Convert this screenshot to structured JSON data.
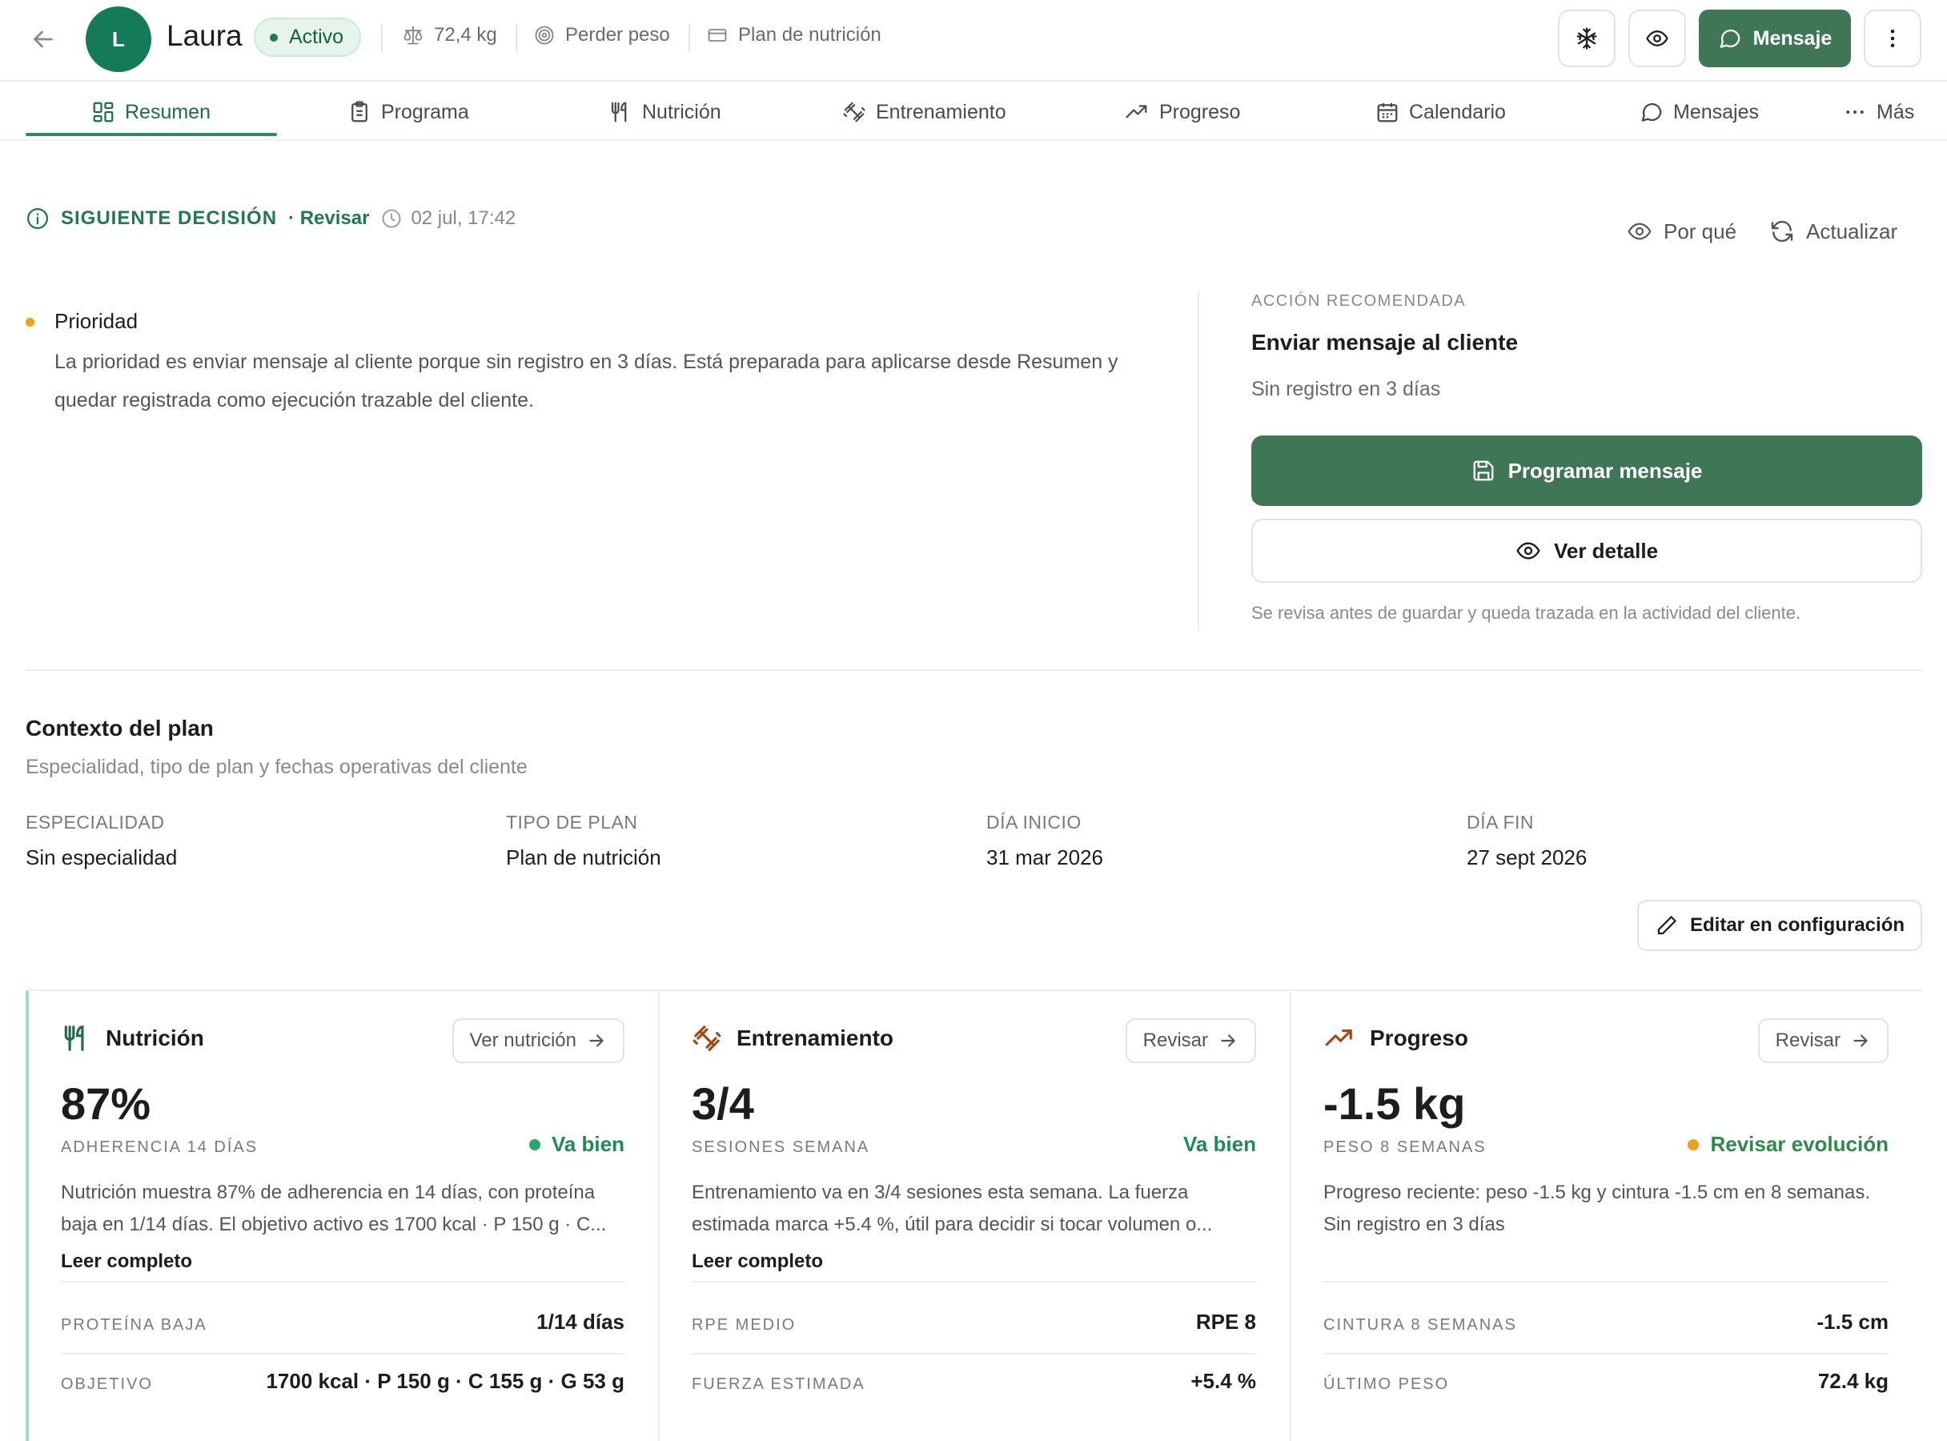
{
  "header": {
    "avatar_initial": "L",
    "client_name": "Laura",
    "status": "Activo",
    "weight": "72,4 kg",
    "goal": "Perder peso",
    "plan": "Plan de nutrición",
    "message_button": "Mensaje"
  },
  "tabs": [
    {
      "label": "Resumen",
      "icon": "dashboard-icon",
      "active": true
    },
    {
      "label": "Programa",
      "icon": "clipboard-icon"
    },
    {
      "label": "Nutrición",
      "icon": "utensils-icon"
    },
    {
      "label": "Entrenamiento",
      "icon": "dumbbell-icon"
    },
    {
      "label": "Progreso",
      "icon": "trend-up-icon"
    },
    {
      "label": "Calendario",
      "icon": "calendar-icon"
    },
    {
      "label": "Mensajes",
      "icon": "chat-icon"
    },
    {
      "label": "Más",
      "icon": "more-horizontal-icon"
    }
  ],
  "decision": {
    "title": "SIGUIENTE DECISIÓN",
    "link": "· Revisar",
    "time": "02 jul, 17:42",
    "why": "Por qué",
    "refresh": "Actualizar",
    "priority_title": "Prioridad",
    "priority_text": "La prioridad es enviar mensaje al cliente porque sin registro en 3 días. Está preparada para aplicarse desde Resumen y quedar registrada como ejecución trazable del cliente."
  },
  "recommended": {
    "label": "ACCIÓN RECOMENDADA",
    "title": "Enviar mensaje al cliente",
    "subtitle": "Sin registro en 3 días",
    "primary_button": "Programar mensaje",
    "secondary_button": "Ver detalle",
    "note": "Se revisa antes de guardar y queda trazada en la actividad del cliente."
  },
  "context": {
    "title": "Contexto del plan",
    "subtitle": "Especialidad, tipo de plan y fechas operativas del cliente",
    "fields": [
      {
        "label": "ESPECIALIDAD",
        "value": "Sin especialidad"
      },
      {
        "label": "TIPO DE PLAN",
        "value": "Plan de nutrición"
      },
      {
        "label": "DÍA INICIO",
        "value": "31 mar 2026"
      },
      {
        "label": "DÍA FIN",
        "value": "27 sept 2026"
      }
    ],
    "edit_button": "Editar en configuración"
  },
  "cards": [
    {
      "title": "Nutrición",
      "icon": "utensils-icon",
      "button": "Ver nutrición",
      "value": "87%",
      "kpi_label": "ADHERENCIA 14 DÍAS",
      "status": "Va bien",
      "status_color": "#1f8a55",
      "status_dot": true,
      "description": "Nutrición muestra 87% de adherencia en 14 días, con proteína baja en 1/14 días. El objetivo activo es 1700 kcal · P 150 g · C...",
      "read_more": "Leer completo",
      "rows": [
        {
          "label": "PROTEÍNA BAJA",
          "value": "1/14 días"
        },
        {
          "label": "OBJETIVO",
          "value": "1700 kcal · P 150 g · C 155 g · G 53 g"
        }
      ]
    },
    {
      "title": "Entrenamiento",
      "icon": "dumbbell-icon",
      "button": "Revisar",
      "value": "3/4",
      "kpi_label": "SESIONES SEMANA",
      "status": "Va bien",
      "status_color": "#1f8a55",
      "status_dot": false,
      "description": "Entrenamiento va en 3/4 sesiones esta semana. La fuerza estimada marca +5.4 %, útil para decidir si tocar volumen o...",
      "read_more": "Leer completo",
      "rows": [
        {
          "label": "RPE MEDIO",
          "value": "RPE 8"
        },
        {
          "label": "FUERZA ESTIMADA",
          "value": "+5.4 %"
        }
      ]
    },
    {
      "title": "Progreso",
      "icon": "trend-up-icon",
      "button": "Revisar",
      "value": "-1.5 kg",
      "kpi_label": "PESO 8 SEMANAS",
      "status": "Revisar evolución",
      "status_color": "#b8860b",
      "status_dot": true,
      "description": "Progreso reciente: peso -1.5 kg y cintura -1.5 cm en 8 semanas. Sin registro en 3 días",
      "read_more": "",
      "rows": [
        {
          "label": "CINTURA 8 SEMANAS",
          "value": "-1.5 cm"
        },
        {
          "label": "ÚLTIMO PESO",
          "value": "72.4 kg"
        }
      ]
    }
  ],
  "colors": {
    "accent": "#3f7656",
    "accent_text": "#1f7a50",
    "avatar": "#147a5a",
    "warning_dot": "#f0a020",
    "training_icon": "#a04a1c"
  }
}
